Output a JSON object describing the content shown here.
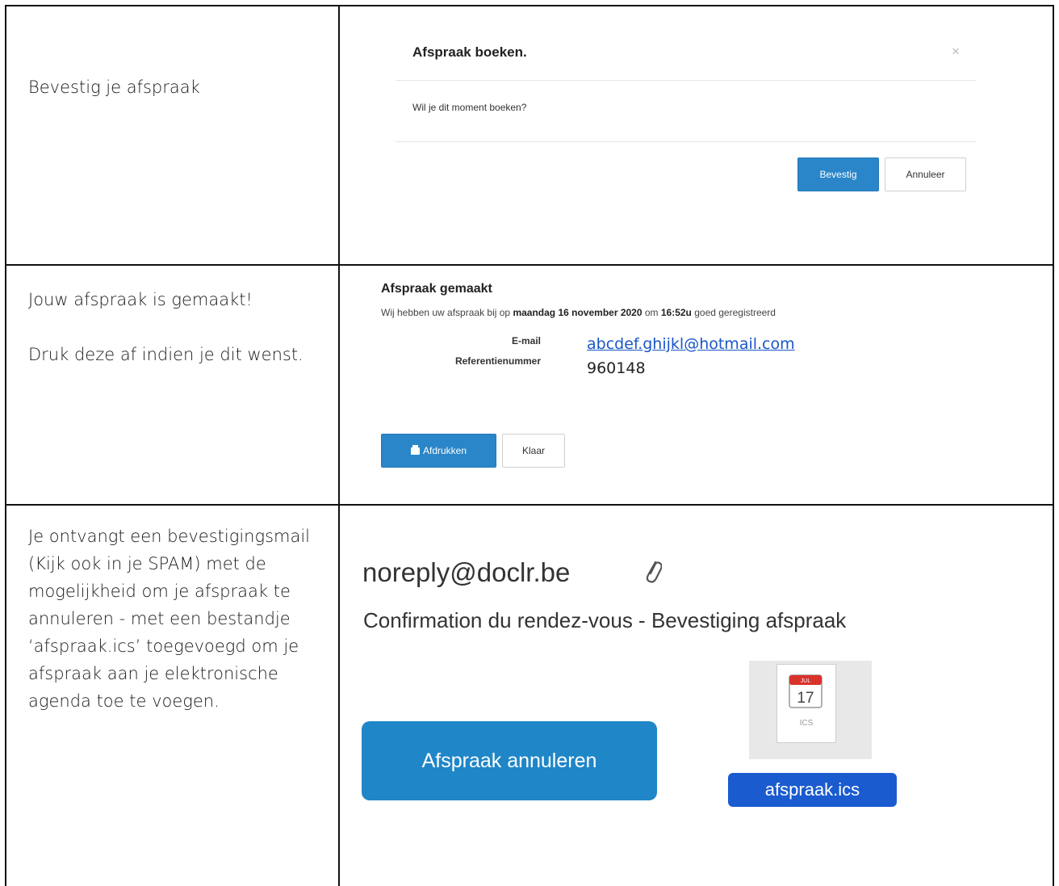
{
  "rows": [
    {
      "instruction": [
        "Bevestig je afspraak"
      ],
      "modal": {
        "title": "Afspraak boeken.",
        "close": "×",
        "body": "Wil je dit moment boeken?",
        "confirm_label": "Bevestig",
        "cancel_label": "Annuleer"
      }
    },
    {
      "instruction": [
        "Jouw afspraak is gemaakt!",
        "Druk deze af indien je dit wenst."
      ],
      "result": {
        "title": "Afspraak gemaakt",
        "text_prefix": "Wij hebben uw afspraak bij op ",
        "date": "maandag 16 november 2020",
        "text_mid": " om ",
        "time": "16:52u",
        "text_suffix": " goed geregistreerd",
        "email_label": "E-mail",
        "email_value": "abcdef.ghijkl@hotmail.com",
        "ref_label": "Referentienummer",
        "ref_value": "960148",
        "print_label": "Afdrukken",
        "done_label": "Klaar"
      }
    },
    {
      "instruction": [
        "Je ontvangt een bevestigingsmail (Kijk ook in je SPAM) met de mogelijkheid om je afspraak te annuleren - met een bestandje ‘afspraak.ics’ toegevoegd om je afspraak aan je elektronische agenda toe te voegen."
      ],
      "email": {
        "from": "noreply@doclr.be",
        "subject": "Confirmation du rendez-vous - Bevestiging afspraak",
        "cancel_button": "Afspraak annuleren",
        "attachment_name": "afspraak.ics",
        "attachment_type": "ICS",
        "calendar_day": "17",
        "calendar_month": "JUL"
      }
    }
  ],
  "colors": {
    "primary_button": "#2a86c8",
    "email_button": "#1f86c8",
    "link": "#1a56c7",
    "file_label": "#1a5bd0"
  },
  "icons": [
    "close-icon",
    "printer-icon",
    "paperclip-icon",
    "calendar-file-icon"
  ]
}
